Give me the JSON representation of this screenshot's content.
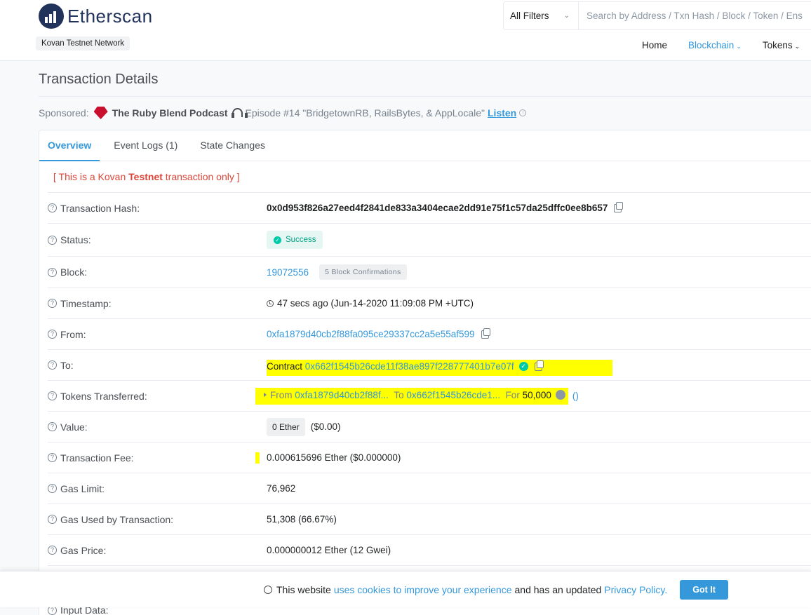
{
  "header": {
    "logo_text": "Etherscan",
    "network": "Kovan Testnet Network",
    "filter_label": "All Filters",
    "search_placeholder": "Search by Address / Txn Hash / Block / Token / Ens",
    "nav": [
      {
        "label": "Home"
      },
      {
        "label": "Blockchain"
      },
      {
        "label": "Tokens"
      }
    ]
  },
  "page": {
    "title": "Transaction Details",
    "sponsored_label": "Sponsored:",
    "sponsor_name": "The Ruby Blend Podcast",
    "sponsor_text": "Episode #14 \"BridgetownRB, RailsBytes, & AppLocale\"",
    "sponsor_link": "Listen"
  },
  "tabs": [
    {
      "label": "Overview"
    },
    {
      "label": "Event Logs (1)"
    },
    {
      "label": "State Changes"
    }
  ],
  "testnet_note": {
    "prefix": "[ This is a Kovan ",
    "bold": "Testnet",
    "suffix": " transaction only ]"
  },
  "details": {
    "hash_label": "Transaction Hash:",
    "hash": "0x0d953f826a27eed4f2841de833a3404ecae2dd91e75f1c57da25dffc0ee8b657",
    "status_label": "Status:",
    "status": "Success",
    "block_label": "Block:",
    "block": "19072556",
    "block_confirmations": "5 Block Confirmations",
    "timestamp_label": "Timestamp:",
    "timestamp": "47 secs ago (Jun-14-2020 11:09:08 PM +UTC)",
    "from_label": "From:",
    "from": "0xfa1879d40cb2f88fa095ce29337cc2a5e55af599",
    "to_label": "To:",
    "to_prefix": "Contract",
    "to": "0x662f1545b26cde11f38ae897f228777401b7e07f",
    "tokens_label": "Tokens Transferred:",
    "tokens_from_word": "From",
    "tokens_from": "0xfa1879d40cb2f88f...",
    "tokens_to_word": "To",
    "tokens_to": "0x662f1545b26cde1...",
    "tokens_for_word": "For",
    "tokens_amount": "50,000",
    "tokens_name": "()",
    "value_label": "Value:",
    "value": "0 Ether",
    "value_usd": "($0.00)",
    "fee_label": "Transaction Fee:",
    "fee": "0.000615696 Ether ($0.000000)",
    "gas_limit_label": "Gas Limit:",
    "gas_limit": "76,962",
    "gas_used_label": "Gas Used by Transaction:",
    "gas_used": "51,308 (66.67%)",
    "gas_price_label": "Gas Price:",
    "gas_price": "0.000000012 Ether (12 Gwei)",
    "input_label": "Input Data:"
  },
  "cookie": {
    "text_before": "This website",
    "link1": "uses cookies to improve your experience",
    "text_mid": "and has an updated",
    "link2": "Privacy Policy.",
    "button": "Got It"
  },
  "colors": {
    "brand": "#21325b",
    "link": "#3498db",
    "success": "#00c9a7",
    "highlight": "#ffff00",
    "testnet_red": "#de4437"
  }
}
